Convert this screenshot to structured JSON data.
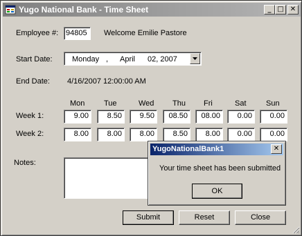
{
  "window": {
    "title": "Yugo National Bank - Time Sheet",
    "minimize": "_",
    "maximize": "□",
    "close": "✕"
  },
  "employee": {
    "label": "Employee #:",
    "number": "94805",
    "welcome": "Welcome Emilie Pastore"
  },
  "start_date": {
    "label": "Start Date:",
    "weekday": "Monday",
    "sep": ",",
    "month": "April",
    "dayyear": "02, 2007"
  },
  "end_date": {
    "label": "End Date:",
    "value": "4/16/2007 12:00:00 AM"
  },
  "days": [
    "Mon",
    "Tue",
    "Wed",
    "Thu",
    "Fri",
    "Sat",
    "Sun"
  ],
  "weeks": [
    {
      "label": "Week 1:",
      "hours": [
        "9.00",
        "8.50",
        "9.50",
        "08.50",
        "08.00",
        "0.00",
        "0.00"
      ]
    },
    {
      "label": "Week 2:",
      "hours": [
        "8.00",
        "8.00",
        "8.00",
        "8.50",
        "8.00",
        "0.00",
        "0.00"
      ]
    }
  ],
  "notes": {
    "label": "Notes:",
    "value": ""
  },
  "buttons": {
    "submit": "Submit",
    "reset": "Reset",
    "close": "Close"
  },
  "dialog": {
    "title": "YugoNationalBank1",
    "message": "Your time sheet has been submitted",
    "ok": "OK",
    "close": "✕"
  }
}
